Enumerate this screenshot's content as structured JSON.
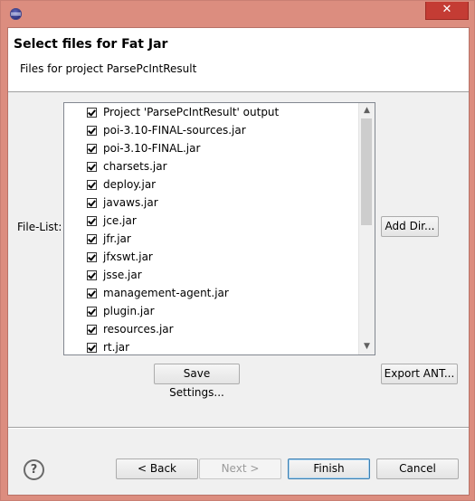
{
  "window": {
    "close_glyph": "✕"
  },
  "header": {
    "title": "Select files for Fat Jar",
    "subtitle": "Files for project ParsePcIntResult"
  },
  "file_list": {
    "label": "File-List:",
    "items": [
      {
        "label": "Project 'ParsePcIntResult' output",
        "checked": true
      },
      {
        "label": "poi-3.10-FINAL-sources.jar",
        "checked": true
      },
      {
        "label": "poi-3.10-FINAL.jar",
        "checked": true
      },
      {
        "label": "charsets.jar",
        "checked": true
      },
      {
        "label": "deploy.jar",
        "checked": true
      },
      {
        "label": "javaws.jar",
        "checked": true
      },
      {
        "label": "jce.jar",
        "checked": true
      },
      {
        "label": "jfr.jar",
        "checked": true
      },
      {
        "label": "jfxswt.jar",
        "checked": true
      },
      {
        "label": "jsse.jar",
        "checked": true
      },
      {
        "label": "management-agent.jar",
        "checked": true
      },
      {
        "label": "plugin.jar",
        "checked": true
      },
      {
        "label": "resources.jar",
        "checked": true
      },
      {
        "label": "rt.jar",
        "checked": true
      }
    ],
    "scroll_up_glyph": "▲",
    "scroll_down_glyph": "▼"
  },
  "buttons": {
    "add_dir": "Add Dir...",
    "save_settings": "Save Settings...",
    "export_ant": "Export ANT...",
    "back": "< Back",
    "next": "Next >",
    "finish": "Finish",
    "cancel": "Cancel"
  },
  "help": {
    "glyph": "?"
  },
  "colors": {
    "title_bar": "#dc8d7f",
    "close_button": "#c43c34",
    "default_button_border": "#3c7fb1"
  },
  "icons": {
    "app": "eclipse-icon",
    "close": "close-icon",
    "help": "help-icon"
  }
}
